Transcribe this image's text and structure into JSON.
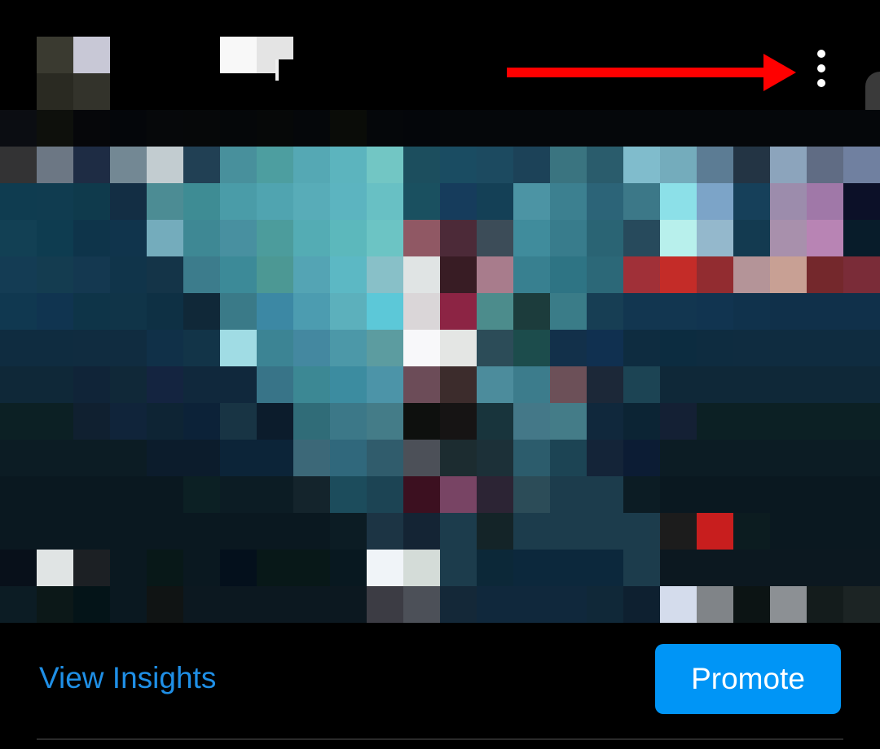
{
  "header": {
    "avatar_pixels": [
      "#3a3a30",
      "#c8c8d6",
      "#2a2a22",
      "#33332b"
    ],
    "more_icon": "vertical-ellipsis",
    "annotation_arrow_color": "#ff0000"
  },
  "post": {
    "top_strip_colors": [
      "#0b0d12",
      "#0e100c",
      "#06070a",
      "#04060a",
      "#06080a",
      "#060809",
      "#050709",
      "#060808",
      "#05070a",
      "#0a0c08",
      "#05070a",
      "#04060a",
      "#05070a",
      "#05070a",
      "#05070a",
      "#05070a",
      "#05070a",
      "#05070a",
      "#05070a",
      "#05070a",
      "#05070a",
      "#05070a",
      "#05070a",
      "#05070a"
    ],
    "media_rows": [
      [
        "#333334",
        "#6c7784",
        "#1e2c44",
        "#738894",
        "#c2ccd0",
        "#214054",
        "#48909c",
        "#4d9ea0",
        "#55a8b4",
        "#5cb4be",
        "#72c6c4",
        "#1c4e5e",
        "#1a4c62",
        "#1c4a60",
        "#1c4258",
        "#3a7480",
        "#2a5c6c",
        "#80bccc",
        "#74acbc",
        "#5c7c94",
        "#233444",
        "#8ca4bc",
        "#606c84",
        "#7080a0"
      ],
      [
        "#0f3c50",
        "#103c50",
        "#0f3a4c",
        "#132e44",
        "#4c8c94",
        "#3e8c94",
        "#4a9ca8",
        "#50a4b0",
        "#58acb8",
        "#5cb4c0",
        "#68c0c4",
        "#1a5060",
        "#163c5c",
        "#144056",
        "#4c94a4",
        "#3c8090",
        "#2c6478",
        "#3c7888",
        "#8ce0e8",
        "#7ca4c8",
        "#16405a",
        "#9c8cac",
        "#a078a8",
        "#0c1028"
      ],
      [
        "#124054",
        "#0e3c50",
        "#0e344a",
        "#10344c",
        "#74acbc",
        "#3e8894",
        "#4890a0",
        "#4c9c9c",
        "#54acb4",
        "#5cb8bc",
        "#6cc4c4",
        "#905864",
        "#4c2a38",
        "#3c4c58",
        "#408c9c",
        "#387c8c",
        "#2a6474",
        "#274a5c",
        "#b8f0ec",
        "#94b8cc",
        "#133a50",
        "#a890ac",
        "#b884b4",
        "#081c2a"
      ],
      [
        "#143c54",
        "#143c50",
        "#143850",
        "#10344a",
        "#143448",
        "#3c7c8c",
        "#3c8a98",
        "#4c9894",
        "#54a4b4",
        "#5cb8c4",
        "#88c0c8",
        "#e0e4e4",
        "#381c24",
        "#a87c8c",
        "#388090",
        "#2e7484",
        "#2c6878",
        "#a03038",
        "#c42c28",
        "#922c30",
        "#b49498",
        "#c8a094",
        "#74282c",
        "#7a2c38"
      ],
      [
        "#103850",
        "#103450",
        "#0e3448",
        "#103448",
        "#0e3044",
        "#102838",
        "#3a7a88",
        "#3c88a4",
        "#4c9cb0",
        "#5cb0bc",
        "#5cc8d8",
        "#dad6d8",
        "#8c2444",
        "#4c8c8c",
        "#1c3c3c",
        "#3a7c88",
        "#173e54",
        "#123650",
        "#123650",
        "#113450",
        "#10324c",
        "#10304a",
        "#10304a",
        "#10304a"
      ],
      [
        "#0f2c40",
        "#0f2c40",
        "#102c40",
        "#102c40",
        "#103048",
        "#123448",
        "#a0dce4",
        "#3c8494",
        "#4488a0",
        "#4c98a8",
        "#5c9ca0",
        "#f8f8fa",
        "#e4e6e4",
        "#2c4c58",
        "#1c4c4c",
        "#12304a",
        "#103050",
        "#0e2c40",
        "#0c2c40",
        "#0e2c40",
        "#0f2c40",
        "#0f2c40",
        "#0f2c40",
        "#0f2c40"
      ],
      [
        "#0f2838",
        "#0f2838",
        "#102438",
        "#102838",
        "#142440",
        "#10283c",
        "#10283c",
        "#387488",
        "#3c8894",
        "#3c8ca0",
        "#4c94a8",
        "#6c4c58",
        "#3c2c2c",
        "#4c8c9c",
        "#3c7c8c",
        "#6c5058",
        "#1c2838",
        "#1c4454",
        "#0f2838",
        "#0f2838",
        "#0f2838",
        "#0f2838",
        "#0f2838",
        "#0f2838"
      ],
      [
        "#0c2024",
        "#0c2024",
        "#102030",
        "#10243a",
        "#0e2434",
        "#0c2238",
        "#183444",
        "#0c1c2c",
        "#306c78",
        "#3c7888",
        "#447c88",
        "#0e100e",
        "#161414",
        "#18343c",
        "#447888",
        "#447c88",
        "#10283c",
        "#0c2434",
        "#142034",
        "#0c2024",
        "#0c2024",
        "#0c2024",
        "#0c2024",
        "#0c2024"
      ],
      [
        "#0c1c24",
        "#0c1c24",
        "#0c1c24",
        "#0c1c24",
        "#0c1c2c",
        "#0c1c2c",
        "#0c2438",
        "#0c2438",
        "#3c6878",
        "#30687c",
        "#305c6c",
        "#4c5058",
        "#1c2c30",
        "#1c3038",
        "#2c5c6c",
        "#1c4454",
        "#142438",
        "#0c1c34",
        "#0c1c24",
        "#0c1c24",
        "#0c1c24",
        "#0c1c24",
        "#0c1c24",
        "#0c1c24"
      ],
      [
        "#0a1820",
        "#0a1820",
        "#0a1820",
        "#0a1820",
        "#0a1820",
        "#0c2024",
        "#0c1c24",
        "#0c1c24",
        "#14242c",
        "#1c4c5c",
        "#1c4454",
        "#3c1020",
        "#784464",
        "#2c2434",
        "#2c4c58",
        "#1c3c4c",
        "#1c3c4c",
        "#0c1c24",
        "#0a1820",
        "#0a1820",
        "#0a1820",
        "#0a1820",
        "#0a1820",
        "#0a1820"
      ],
      [
        "#0a1820",
        "#0a1820",
        "#0a1820",
        "#0a1820",
        "#0a1820",
        "#0a1820",
        "#0a1820",
        "#0a1820",
        "#0a1820",
        "#0c1c24",
        "#1c3444",
        "#142434",
        "#1c3c4c",
        "#142428",
        "#1c3c4c",
        "#1c3c4c",
        "#1c3c4c",
        "#1c3c4c",
        "#1c1c1c",
        "#c81e1e",
        "#0c1c20",
        "#0a1820",
        "#0a1820",
        "#0a1820"
      ],
      [
        "#08101a",
        "#e0e4e4",
        "#1c2024",
        "#0a1820",
        "#081818",
        "#0a1820",
        "#04101c",
        "#081818",
        "#081818",
        "#081820",
        "#f0f4f8",
        "#d4dcd8",
        "#1c3c4c",
        "#0c2838",
        "#0c283c",
        "#0c283c",
        "#0c283c",
        "#1c3c4c",
        "#0c1820",
        "#0c1820",
        "#0c1820",
        "#0c1820",
        "#0c1820",
        "#0c1820"
      ],
      [
        "#0c1c24",
        "#0c1818",
        "#041418",
        "#0a1820",
        "#101414",
        "#0c1820",
        "#0c1820",
        "#0c1820",
        "#0c1820",
        "#0c1820",
        "#3c3c44",
        "#4c5058",
        "#142838",
        "#10283c",
        "#10283c",
        "#10283c",
        "#102838",
        "#0e2030",
        "#d4dcec",
        "#808488",
        "#0c1414",
        "#8c9094",
        "#141c1c",
        "#1c2424"
      ]
    ]
  },
  "actions": {
    "insights_label": "View Insights",
    "promote_label": "Promote"
  },
  "colors": {
    "link": "#1f8fe6",
    "primary_button": "#0095f6",
    "background": "#000000"
  }
}
